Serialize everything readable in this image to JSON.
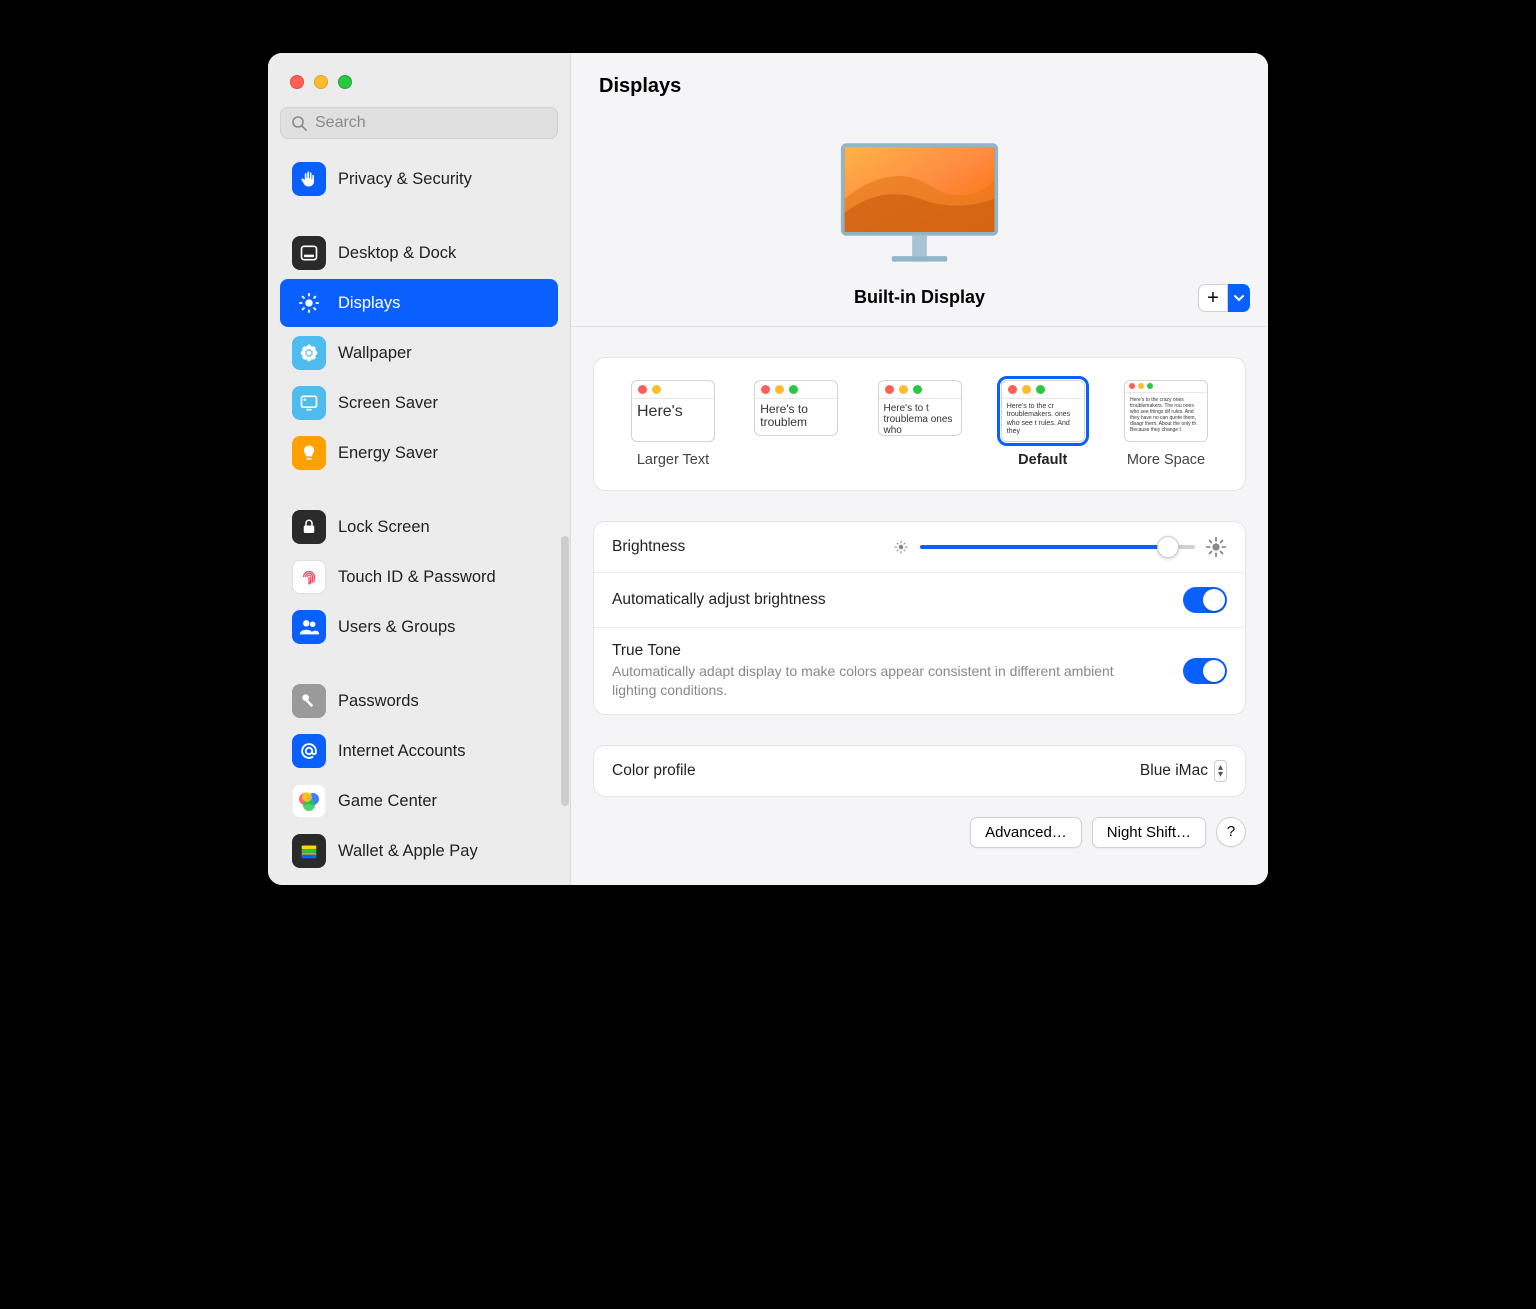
{
  "window": {
    "title": "Displays"
  },
  "search": {
    "placeholder": "Search"
  },
  "sidebar": {
    "items": [
      {
        "label": "Privacy & Security"
      },
      {
        "label": "Desktop & Dock"
      },
      {
        "label": "Displays"
      },
      {
        "label": "Wallpaper"
      },
      {
        "label": "Screen Saver"
      },
      {
        "label": "Energy Saver"
      },
      {
        "label": "Lock Screen"
      },
      {
        "label": "Touch ID & Password"
      },
      {
        "label": "Users & Groups"
      },
      {
        "label": "Passwords"
      },
      {
        "label": "Internet Accounts"
      },
      {
        "label": "Game Center"
      },
      {
        "label": "Wallet & Apple Pay"
      }
    ]
  },
  "display": {
    "name": "Built-in Display",
    "resolutions": [
      {
        "label": "Larger Text",
        "sample": "Here's"
      },
      {
        "label": "",
        "sample": "Here's to troublem"
      },
      {
        "label": "",
        "sample": "Here's to t troublema ones who"
      },
      {
        "label": "Default",
        "sample": "Here's to the cr troublemakers. ones who see t rules. And they"
      },
      {
        "label": "More Space",
        "sample": "Here's to the crazy ones troublemakers. The rou ones who see things dif rules. And they have no can quote them, disagr them. About the only th Because they change t"
      }
    ],
    "brightness": {
      "label": "Brightness",
      "percent": 90
    },
    "auto_brightness": {
      "label": "Automatically adjust brightness",
      "on": true
    },
    "true_tone": {
      "label": "True Tone",
      "desc": "Automatically adapt display to make colors appear consistent in different ambient lighting conditions.",
      "on": true
    },
    "color_profile": {
      "label": "Color profile",
      "value": "Blue iMac"
    }
  },
  "footer": {
    "advanced": "Advanced…",
    "night_shift": "Night Shift…",
    "help": "?"
  }
}
